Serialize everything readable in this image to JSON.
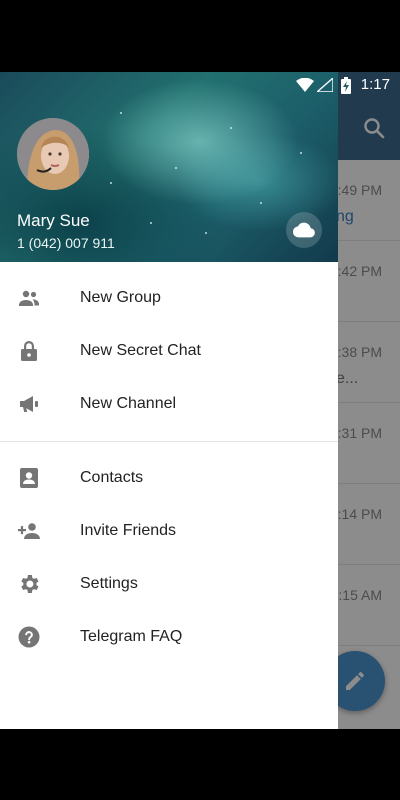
{
  "status_bar": {
    "time": "1:17"
  },
  "background_chat_list": {
    "rows": [
      {
        "time": "4:49 PM",
        "snippet": "ng",
        "snippet_style": "link"
      },
      {
        "time": "4:42 PM",
        "snippet": "",
        "snippet_style": "plain"
      },
      {
        "time": "4:38 PM",
        "snippet": "e...",
        "snippet_style": "plain"
      },
      {
        "time": "4:31 PM",
        "snippet": "",
        "snippet_style": "plain"
      },
      {
        "time": "4:14 PM",
        "snippet": "",
        "snippet_style": "plain"
      },
      {
        "time": "4:15 AM",
        "snippet": "",
        "snippet_style": "plain"
      }
    ]
  },
  "drawer": {
    "user": {
      "name": "Mary Sue",
      "phone": "1 (042) 007 911"
    },
    "menu_primary": [
      {
        "label": "New Group",
        "icon": "group-icon"
      },
      {
        "label": "New Secret Chat",
        "icon": "lock-icon"
      },
      {
        "label": "New Channel",
        "icon": "megaphone-icon"
      }
    ],
    "menu_secondary": [
      {
        "label": "Contacts",
        "icon": "contacts-icon"
      },
      {
        "label": "Invite Friends",
        "icon": "add-person-icon"
      },
      {
        "label": "Settings",
        "icon": "gear-icon"
      },
      {
        "label": "Telegram FAQ",
        "icon": "help-icon"
      }
    ]
  },
  "colors": {
    "header_blue": "#3e6b8e",
    "fab_blue": "#4b95cf",
    "icon_gray": "#757575",
    "link_blue": "#3a7fc1"
  }
}
